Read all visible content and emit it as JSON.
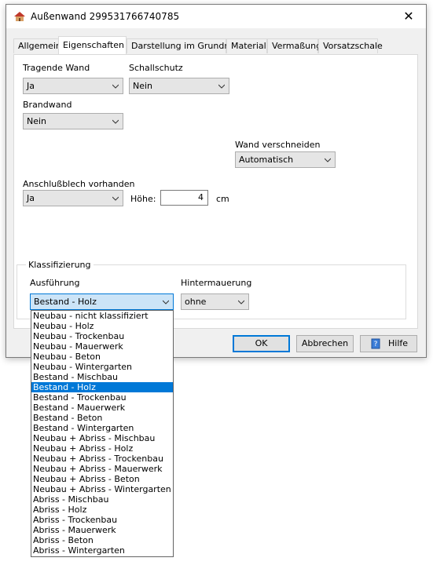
{
  "window": {
    "title": "Außenwand 299531766740785"
  },
  "tabs": [
    {
      "label": "Allgemein"
    },
    {
      "label": "Eigenschaften"
    },
    {
      "label": "Darstellung im Grundriss"
    },
    {
      "label": "Material"
    },
    {
      "label": "Vermaßung"
    },
    {
      "label": "Vorsatzschale"
    }
  ],
  "fields": {
    "tragende_wand": {
      "label": "Tragende Wand",
      "value": "Ja"
    },
    "schallschutz": {
      "label": "Schallschutz",
      "value": "Nein"
    },
    "brandwand": {
      "label": "Brandwand",
      "value": "Nein"
    },
    "wand_verschneiden": {
      "label": "Wand verschneiden",
      "value": "Automatisch"
    },
    "anschlussblech": {
      "label": "Anschlußblech vorhanden",
      "value": "Ja"
    },
    "hoehe": {
      "label": "Höhe:",
      "value": "4",
      "unit": "cm"
    }
  },
  "klassifizierung": {
    "title": "Klassifizierung",
    "ausfuehrung": {
      "label": "Ausführung",
      "value": "Bestand - Holz"
    },
    "hintermauerung": {
      "label": "Hintermauerung",
      "value": "ohne"
    }
  },
  "buttons": {
    "ok": "OK",
    "abbrechen": "Abbrechen",
    "hilfe": "Hilfe"
  },
  "dropdown_options": [
    "Neubau - nicht klassifiziert",
    "Neubau - Holz",
    "Neubau - Trockenbau",
    "Neubau - Mauerwerk",
    "Neubau - Beton",
    "Neubau - Wintergarten",
    "Bestand - Mischbau",
    "Bestand - Holz",
    "Bestand - Trockenbau",
    "Bestand - Mauerwerk",
    "Bestand - Beton",
    "Bestand - Wintergarten",
    "Neubau + Abriss - Mischbau",
    "Neubau + Abriss - Holz",
    "Neubau + Abriss - Trockenbau",
    "Neubau + Abriss - Mauerwerk",
    "Neubau + Abriss - Beton",
    "Neubau + Abriss - Wintergarten",
    "Abriss - Mischbau",
    "Abriss - Holz",
    "Abriss - Trockenbau",
    "Abriss - Mauerwerk",
    "Abriss - Beton",
    "Abriss - Wintergarten"
  ],
  "dropdown_selected_value": "Bestand - Holz",
  "colors": {
    "accent": "#0078d7",
    "panel": "#ffffff",
    "dialog": "#f0f0f0"
  }
}
